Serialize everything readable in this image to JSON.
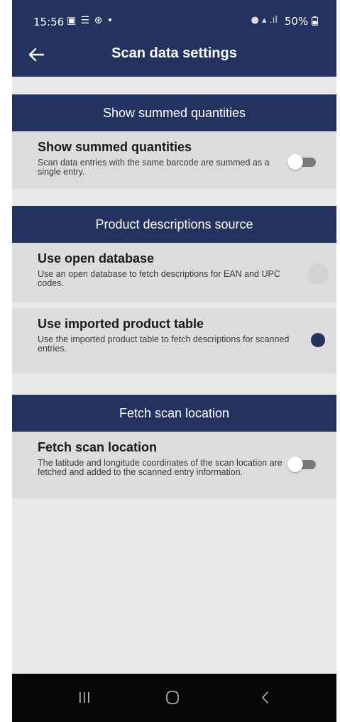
{
  "status_bar": {
    "time": "15:56",
    "left_icons": "▣ ☰ ⊛ •",
    "signal": "● ▴ .ıl",
    "battery": "50%"
  },
  "app_bar": {
    "title": "Scan data settings",
    "back_icon": "arrow-left-icon"
  },
  "sections": [
    {
      "header": "Show summed quantities",
      "rows": [
        {
          "title": "Show summed quantities",
          "description": "Scan data entries with the same barcode are summed as a single entry.",
          "control": "toggle",
          "value": false
        }
      ]
    },
    {
      "header": "Product descriptions source",
      "rows": [
        {
          "title": "Use open database",
          "description": "Use an open database to fetch descriptions for EAN and UPC codes.",
          "control": "radio",
          "value": false
        },
        {
          "title": "Use imported product table",
          "description": "Use the imported product table to fetch descriptions for scanned entries.",
          "control": "radio",
          "value": true
        }
      ]
    },
    {
      "header": "Fetch scan location",
      "rows": [
        {
          "title": "Fetch scan location",
          "description": "The latitude and longitude coordinates of the scan location are fetched and added to the scanned entry information.",
          "control": "toggle",
          "value": false
        }
      ]
    }
  ],
  "nav_bar": {
    "recent_icon": "recent-apps-icon",
    "home_icon": "home-icon",
    "back_icon": "back-chevron-icon"
  },
  "colors": {
    "primary": "#23325f",
    "background": "#e8e8e8",
    "row_background": "#dcdcdc",
    "navbar": "#070707"
  }
}
